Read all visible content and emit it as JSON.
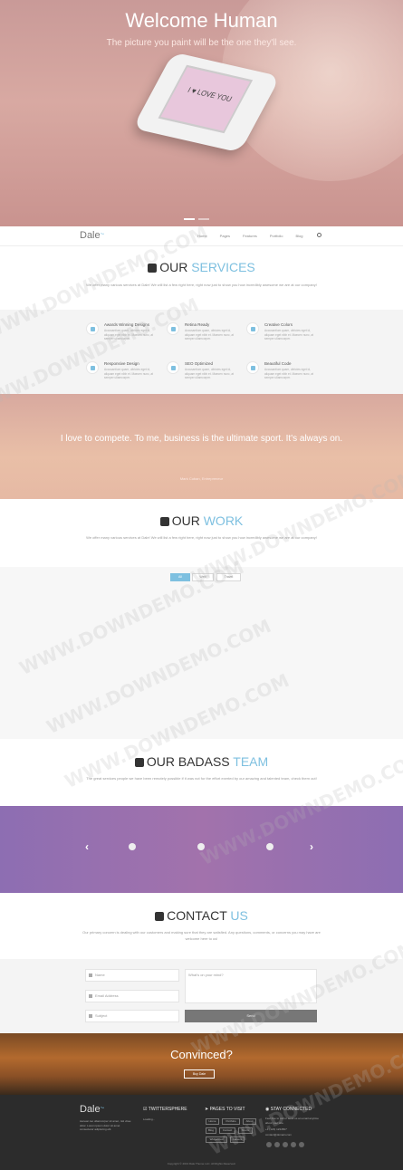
{
  "hero": {
    "title": "Welcome Human",
    "subtitle": "The picture you paint will be the one they'll see.",
    "phone_text": "I ♥ LOVE YOU"
  },
  "nav": {
    "logo": "Dale",
    "items": [
      "Home",
      "Pages",
      "Features",
      "Portfolio",
      "Blog"
    ]
  },
  "services": {
    "title_main": "OUR ",
    "title_accent": "SERVICES",
    "desc": "We offer many various services at Dale! We will list a few right here, right now just to show you how incredibly awesome we are at our company!",
    "items": [
      {
        "title": "Awards Winning Designs",
        "desc": "Accusantium quam, ultricies eget id, aliquam eget nibh et. Maecen nunc, at semper ullamcorper."
      },
      {
        "title": "Retina Ready",
        "desc": "Accusantium quam, ultricies eget id, aliquam eget nibh et. Maecen nunc, at semper ullamcorper."
      },
      {
        "title": "Creative Colors",
        "desc": "Accusantium quam, ultricies eget id, aliquam eget nibh et. Maecen nunc, at semper ullamcorper."
      },
      {
        "title": "Responsive Design",
        "desc": "Accusantium quam, ultricies eget id, aliquam eget nibh et. Maecen nunc, at semper ullamcorper."
      },
      {
        "title": "SEO Optimized",
        "desc": "Accusantium quam, ultricies eget id, aliquam eget nibh et. Maecen nunc, at semper ullamcorper."
      },
      {
        "title": "Beautiful Code",
        "desc": "Accusantium quam, ultricies eget id, aliquam eget nibh et. Maecen nunc, at semper ullamcorper."
      }
    ]
  },
  "quote": {
    "text": "I love to compete. To me, business is the ultimate sport. It's always on.",
    "author": "Mark Cuban, Entrepreneur"
  },
  "work": {
    "title_main": "OUR ",
    "title_accent": "WORK",
    "desc": "We offer many various services at Dale! We will list a few right here, right now just to show you how incredibly awesome we are at our company!",
    "filters": [
      "All",
      "Web",
      "Travel"
    ]
  },
  "team": {
    "title_main": "OUR BADASS ",
    "title_accent": "TEAM",
    "desc": "The great services people we have been remotely possible if it was not for the effort exerted by our amazing and talented team, check them out!",
    "prev": "‹",
    "next": "›"
  },
  "contact": {
    "title_main": "CONTACT ",
    "title_accent": "US",
    "desc": "Our primary concern is dealing with our customers and making sure that they are satisfied. Any questions, comments, or concerns you may have are welcome here to us!",
    "name_placeholder": "Name",
    "email_placeholder": "Email Address",
    "subject_placeholder": "Subject",
    "message_placeholder": "What's on your mind?",
    "send": "Send"
  },
  "cta": {
    "title": "Convinced?",
    "button": "Buy Dale"
  },
  "footer": {
    "logo": "Dale",
    "about": "Aenean leo ullamcorper sit amet, nisl vitae dolor. Lorem ipsum dolor sit amet consectetur adipiscing elit.",
    "twitter_title": "TWITTERSPHERE",
    "twitter_text": "Loading...",
    "pages_title": "PAGES TO VISIT",
    "pages": [
      "Home",
      "Portfolio",
      "About",
      "Blog",
      "Contact",
      "Shortc",
      "Widgetized",
      "Careers"
    ],
    "contact_title": "STAY CONNECTED",
    "contact_text": "Feel free to call or send us an email anytime about your site.",
    "phone": "+1 (123) 1234567",
    "email": "contact@domain.com",
    "copyright": "Copyright © 2013 Dale Theme LLC. All Rights Reserved."
  },
  "watermark": "WWW.DOWNDEMO.COM",
  "colors": {
    "accent": "#7ec0e0",
    "team_band": "#9a70ae",
    "footer": "#2c2c2c"
  }
}
